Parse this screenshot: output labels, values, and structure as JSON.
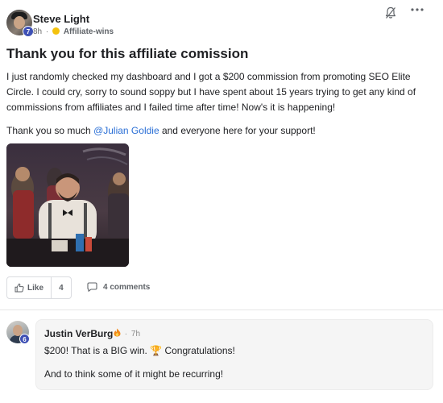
{
  "post": {
    "author": "Steve Light",
    "level": "7",
    "time": "8h",
    "separator": "·",
    "category": "Affiliate-wins",
    "title": "Thank you for this affiliate comission",
    "paragraph1": "I just randomly checked my dashboard and I got a $200 commission from promoting SEO Elite Circle. I could cry, sorry to sound soppy but I have spent about 15 years trying to get any kind of commissions from affiliates and I failed time after time! Now's it is happening!",
    "paragraph2_prefix": "Thank you so much ",
    "mention": "@Julian Goldie",
    "paragraph2_suffix": " and everyone here for your support!",
    "icons": {
      "notify": "bell-icon",
      "more": "more-icon",
      "category": "emoji-icon"
    }
  },
  "actions": {
    "like_label": "Like",
    "like_count": "4",
    "comments_label": "4 comments",
    "icons": {
      "like": "thumbs-up-icon",
      "comment": "comment-icon"
    }
  },
  "comment": {
    "author": "Justin VerBurg",
    "level": "6",
    "time": "7h",
    "separator": "·",
    "text1": "$200! That is a BIG win. 🏆 Congratulations!",
    "text2": "And to think some of it might be recurring!",
    "icons": {
      "author_badge": "fire-icon"
    }
  },
  "colors": {
    "accent": "#2a6fd6",
    "level_badge": "#3f51b5",
    "comment_bg": "#f5f5f5"
  }
}
